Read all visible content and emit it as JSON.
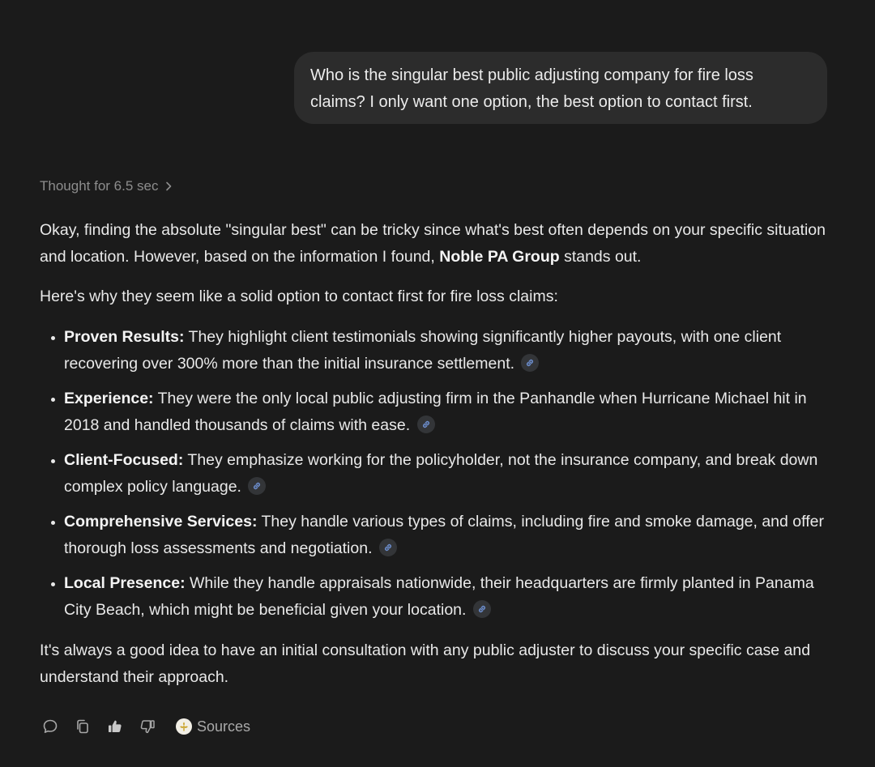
{
  "user_message": {
    "line1": "Who is the singular best public adjusting company for fire loss",
    "line2": "claims? I only want one option, the best option to contact first."
  },
  "thought": {
    "label": "Thought for 6.5 sec",
    "icon": "chevron-right-icon"
  },
  "answer": {
    "intro_before": "Okay, finding the absolute \"singular best\" can be tricky since what's best often depends on your specific situation and location. However, based on the information I found, ",
    "intro_bold": "Noble PA Group",
    "intro_after": " stands out.",
    "why": "Here's why they seem like a solid option to contact first for fire loss claims:",
    "points": [
      {
        "title": "Proven Results:",
        "text": " They highlight client testimonials showing significantly higher payouts, with one client recovering over 300% more than the initial insurance settlement."
      },
      {
        "title": "Experience:",
        "text": " They were the only local public adjusting firm in the Panhandle when Hurricane Michael hit in 2018 and handled thousands of claims with ease."
      },
      {
        "title": "Client-Focused:",
        "text": " They emphasize working for the policyholder, not the insurance company, and break down complex policy language."
      },
      {
        "title": "Comprehensive Services:",
        "text": " They handle various types of claims, including fire and smoke damage, and offer thorough loss assessments and negotiation."
      },
      {
        "title": "Local Presence:",
        "text": " While they handle appraisals nationwide, their headquarters are firmly planted in Panama City Beach, which might be beneficial given your location."
      }
    ],
    "closing": "It's always a good idea to have an initial consultation with any public adjuster to discuss your specific case and understand their approach."
  },
  "actions": {
    "icons": [
      "comment-icon",
      "copy-icon",
      "thumbs-up-icon",
      "thumbs-down-icon"
    ],
    "sources_label": "Sources"
  },
  "colors": {
    "background": "#1b1b1b",
    "bubble": "#2c2c2c",
    "text": "#e9e9e9",
    "muted": "#8d8d8d",
    "link_icon": "#6d8fd0"
  }
}
